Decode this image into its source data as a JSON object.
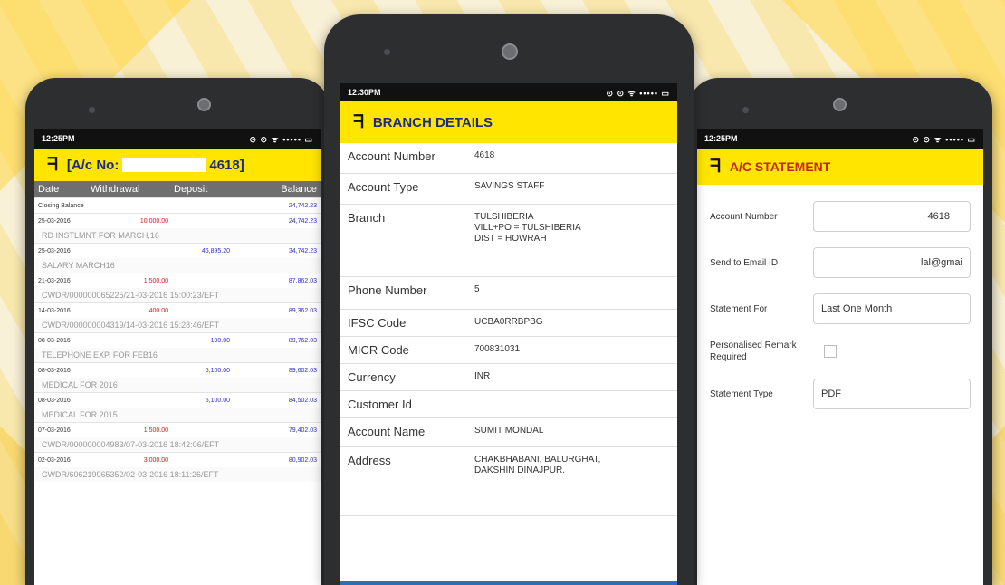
{
  "phone_left": {
    "status": {
      "time": "12:25PM",
      "icons": "⊙ ⊙ ᯤ ••••• ▭"
    },
    "title": "[A/c No:",
    "account_suffix": "4618]",
    "columns": [
      "Date",
      "Withdrawal",
      "Deposit",
      "Balance"
    ],
    "closing_label": "Closing Balance",
    "closing_balance": "24,742.23",
    "transactions": [
      {
        "date": "25-03-2016",
        "withdrawal": "10,000.00",
        "deposit": "",
        "balance": "24,742.23",
        "desc": "RD INSTLMNT FOR MARCH,16"
      },
      {
        "date": "25-03-2016",
        "withdrawal": "",
        "deposit": "46,895.20",
        "balance": "34,742.23",
        "desc": "SALARY MARCH16"
      },
      {
        "date": "21-03-2016",
        "withdrawal": "1,500.00",
        "deposit": "",
        "balance": "87,862.03",
        "desc": "CWDR/000000065225/21-03-2016 15:00:23/EFT"
      },
      {
        "date": "14-03-2016",
        "withdrawal": "400.00",
        "deposit": "",
        "balance": "89,362.03",
        "desc": "CWDR/000000004319/14-03-2016 15:28:46/EFT"
      },
      {
        "date": "08-03-2016",
        "withdrawal": "",
        "deposit": "190.00",
        "balance": "89,762.03",
        "desc": "TELEPHONE EXP. FOR FEB16"
      },
      {
        "date": "08-03-2016",
        "withdrawal": "",
        "deposit": "5,100.00",
        "balance": "89,602.03",
        "desc": "MEDICAL FOR 2016"
      },
      {
        "date": "08-03-2016",
        "withdrawal": "",
        "deposit": "5,100.00",
        "balance": "84,502.03",
        "desc": "MEDICAL FOR 2015"
      },
      {
        "date": "07-03-2016",
        "withdrawal": "1,500.00",
        "deposit": "",
        "balance": "79,402.03",
        "desc": "CWDR/000000004983/07-03-2016 18:42:06/EFT"
      },
      {
        "date": "02-03-2016",
        "withdrawal": "3,000.00",
        "deposit": "",
        "balance": "80,902.03",
        "desc": "CWDR/606219965352/02-03-2016 18:11:26/EFT"
      }
    ]
  },
  "phone_center": {
    "status": {
      "time": "12:30PM",
      "icons": "⊙ ⊙ ᯤ ••••• ▭"
    },
    "title": "BRANCH DETAILS",
    "rows": [
      {
        "label": "Account Number",
        "value": "4618"
      },
      {
        "label": "Account Type",
        "value": "SAVINGS STAFF"
      },
      {
        "label": "Branch",
        "value": "TULSHIBERIA\nVILL+PO = TULSHIBERIA\nDIST = HOWRAH"
      },
      {
        "label": "Phone Number",
        "value": "5"
      },
      {
        "label": "IFSC Code",
        "value": "UCBA0RRBPBG"
      },
      {
        "label": "MICR Code",
        "value": "700831031"
      },
      {
        "label": "Currency",
        "value": "INR"
      },
      {
        "label": "Customer Id",
        "value": ""
      },
      {
        "label": "Account Name",
        "value": "SUMIT MONDAL"
      },
      {
        "label": "Address",
        "value": "CHAKBHABANI, BALURGHAT,\nDAKSHIN DINAJPUR."
      }
    ]
  },
  "phone_right": {
    "status": {
      "time": "12:25PM",
      "icons": "⊙ ⊙ ᯤ ••••• ▭"
    },
    "title": "A/C STATEMENT",
    "account_number_label": "Account Number",
    "account_number_value": "4618",
    "email_label": "Send to Email ID",
    "email_value": "lal@gmai",
    "statement_for_label": "Statement For",
    "statement_for_value": "Last One Month",
    "remark_label": "Personalised Remark Required",
    "statement_type_label": "Statement Type",
    "statement_type_value": "PDF"
  },
  "colors": {
    "appbar": "#ffe500",
    "title_text": "#1a2a8a",
    "withdrawal": "#d02020",
    "deposit": "#3030c0"
  },
  "logo_icon": "bank-logo-icon"
}
